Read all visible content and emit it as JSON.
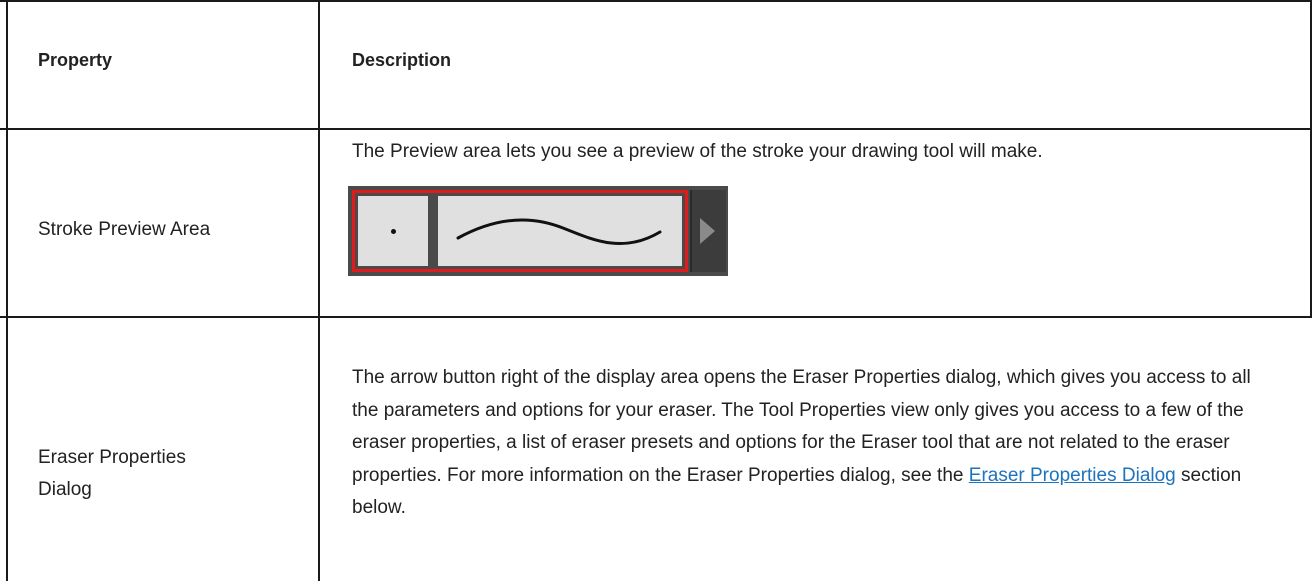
{
  "table": {
    "header": {
      "property": "Property",
      "description": "Description"
    },
    "rows": [
      {
        "property": "Stroke Preview Area",
        "description": "The Preview area lets you see a preview of the stroke your drawing tool will make."
      },
      {
        "property_lines": [
          "Eraser Properties",
          "Dialog"
        ],
        "description_before_link": "The arrow button right of the display area opens the Eraser Properties dialog, which gives you access to all the parameters and options for your eraser. The Tool Properties view only gives you access to a few of the eraser properties, a list of eraser presets and options for the Eraser tool that are not related to the eraser properties. For more information on the Eraser Properties dialog, see the",
        "link_text": "Eraser Properties Dialog",
        "description_after_link": "section below."
      }
    ]
  },
  "preview_widget": {
    "highlight_color": "#e11b1b",
    "arrow_icon": "right-triangle-icon"
  },
  "colors": {
    "link": "#1e73be",
    "border": "#1a1a1a"
  }
}
